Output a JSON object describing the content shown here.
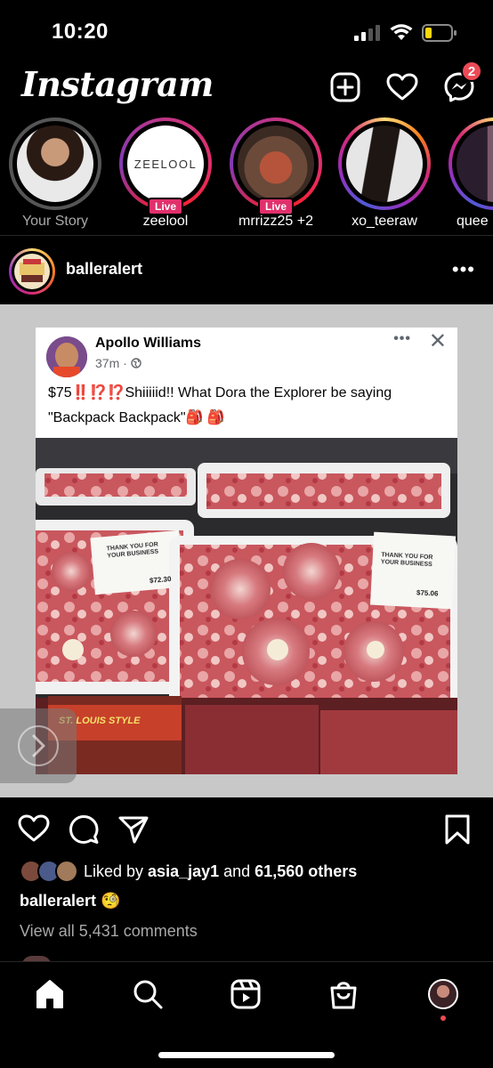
{
  "status_bar": {
    "time": "10:20"
  },
  "header": {
    "logo": "Instagram",
    "new_post_icon": "plus-square-icon",
    "activity_icon": "heart-icon",
    "messenger_icon": "messenger-icon",
    "messages_badge": "2"
  },
  "stories": [
    {
      "label": "Your Story",
      "live": false
    },
    {
      "label": "zeelool",
      "live": true,
      "live_label": "Live",
      "brand_text": "ZEELOOL"
    },
    {
      "label": "mrrizz25 +2",
      "live": true,
      "live_label": "Live"
    },
    {
      "label": "xo_teeraw",
      "live": false
    },
    {
      "label": "quee",
      "live": false
    }
  ],
  "post": {
    "username": "balleralert",
    "more_label": "•••",
    "fb_card": {
      "name": "Apollo Williams",
      "time": "37m · ",
      "dots": "•••",
      "close": "✕",
      "text_line1": "$75‼️⁉️⁉️Shiiiiid!! What Dora the Explorer be saying",
      "text_line2": "\"Backpack Backpack\"🎒 🎒"
    },
    "photo_labels": {
      "thank_you": "THANK YOU FOR YOUR BUSINESS",
      "price_left": "$72.30",
      "price_right": "$75.06",
      "brand": "ST. LOUIS STYLE"
    },
    "liked_by_prefix": "Liked by ",
    "liked_by_user": "asia_jay1",
    "liked_by_mid": " and ",
    "liked_by_count": "61,560 others",
    "caption_user": "balleralert",
    "caption_emoji": "🧐",
    "view_comments": "View all 5,431 comments"
  },
  "tabs": [
    "home-icon",
    "search-icon",
    "reels-icon",
    "shop-icon",
    "profile-avatar"
  ],
  "colors": {
    "background": "#000000",
    "live_red": "#e1306c",
    "badge_red": "#ed4956",
    "muted_text": "#a8a8a8"
  }
}
